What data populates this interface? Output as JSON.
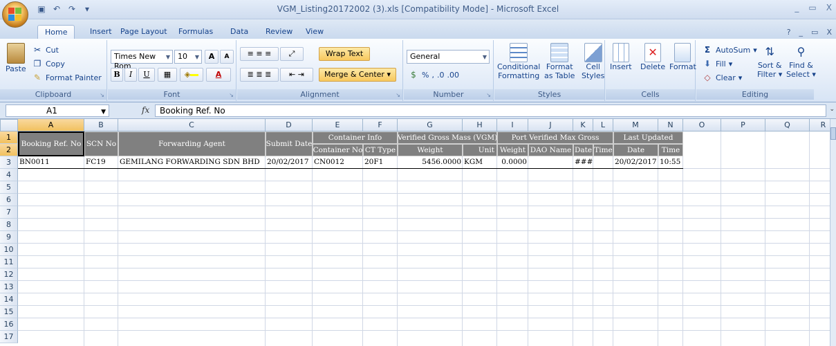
{
  "window": {
    "title": "VGM_Listing20172002 (3).xls  [Compatibility Mode] - Microsoft Excel",
    "controls": [
      "_",
      "▭",
      "X"
    ],
    "doc_controls": [
      "?",
      "_",
      "▭",
      "X"
    ]
  },
  "tabs": [
    "Home",
    "Insert",
    "Page Layout",
    "Formulas",
    "Data",
    "Review",
    "View"
  ],
  "ribbon": {
    "clipboard": {
      "name": "Clipboard",
      "paste": "Paste",
      "cut": "Cut",
      "copy": "Copy",
      "format_painter": "Format Painter"
    },
    "font": {
      "name": "Font",
      "family": "Times New Rom",
      "size": "10",
      "bold": "B",
      "italic": "I",
      "underline": "U"
    },
    "alignment": {
      "name": "Alignment",
      "wrap_text": "Wrap Text",
      "merge_center": "Merge & Center"
    },
    "number": {
      "name": "Number",
      "format": "General",
      "percent": "%",
      "comma": ",",
      "inc": ".0",
      "dec": ".00"
    },
    "styles": {
      "name": "Styles",
      "conditional": "Conditional",
      "conditional2": "Formatting",
      "format_table": "Format",
      "format_table2": "as Table",
      "cell_styles": "Cell",
      "cell_styles2": "Styles"
    },
    "cells": {
      "name": "Cells",
      "insert": "Insert",
      "delete": "Delete",
      "format": "Format"
    },
    "editing": {
      "name": "Editing",
      "autosum": "AutoSum",
      "fill": "Fill",
      "clear": "Clear",
      "sort": "Sort &",
      "sort2": "Filter",
      "find": "Find &",
      "find2": "Select"
    }
  },
  "formula_bar": {
    "cell_ref": "A1",
    "fx": "fx",
    "content": "Booking Ref. No"
  },
  "grid": {
    "columns": [
      "A",
      "B",
      "C",
      "D",
      "E",
      "F",
      "G",
      "H",
      "I",
      "J",
      "K",
      "L",
      "M",
      "N",
      "O",
      "P",
      "Q",
      "R"
    ],
    "rows": [
      "1",
      "2",
      "3",
      "4",
      "5",
      "6",
      "7",
      "8",
      "9",
      "10",
      "11",
      "12",
      "13",
      "14",
      "15",
      "16",
      "17"
    ],
    "headers": {
      "booking": "Booking Ref. No",
      "scn": "SCN No",
      "agent": "Forwarding Agent",
      "submit": "Submit Date",
      "container_info": "Container Info",
      "vgm": "Verified Gross Mass (VGM)",
      "port": "Port Verified Max Gross",
      "last_updated": "Last Updated",
      "container_no": "Container No",
      "ct_type": "CT Type",
      "weight": "Weight",
      "unit": "Unit",
      "pweight": "Weight",
      "dao": "DAO Name",
      "pdate": "Date",
      "ptime": "Time",
      "ldate": "Date",
      "ltime": "Time"
    },
    "row3": {
      "booking": "BN0011",
      "scn": "FC19",
      "agent": "GEMILANG FORWARDING SDN BHD",
      "submit": "20/02/2017",
      "container_no": "CN0012",
      "ct_type": "20F1",
      "weight": "5456.0000",
      "unit": "KGM",
      "pweight": "0.0000",
      "dao": "",
      "pdate": "###",
      "ptime": "",
      "ldate": "20/02/2017",
      "ltime": "10:55"
    }
  }
}
